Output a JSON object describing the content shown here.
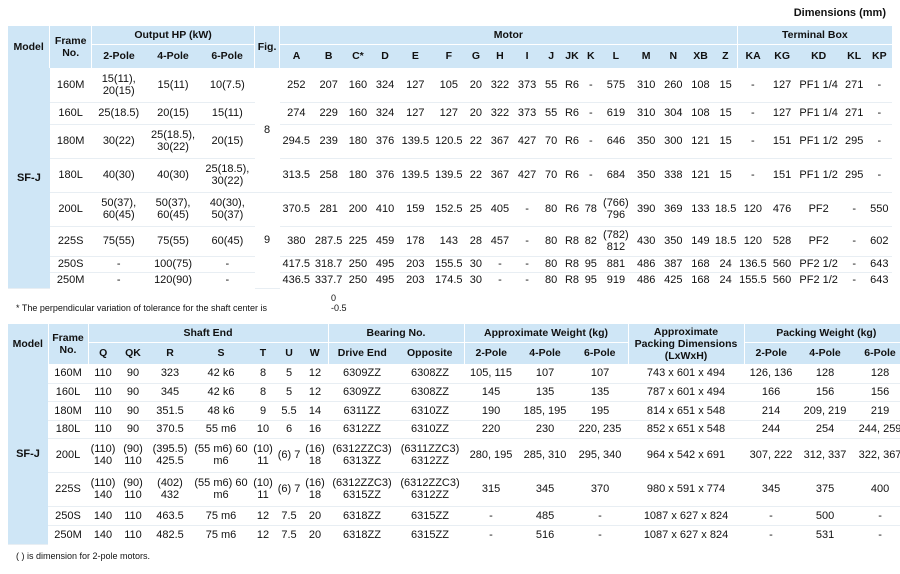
{
  "dims_title": "Dimensions (mm)",
  "t1": {
    "head": {
      "model": "Model",
      "frame": "Frame No.",
      "output": "Output HP (kW)",
      "fig": "Fig.",
      "motor": "Motor",
      "terminal": "Terminal Box",
      "output_cols": [
        "2-Pole",
        "4-Pole",
        "6-Pole"
      ],
      "motor_cols": [
        "A",
        "B",
        "C*",
        "D",
        "E",
        "F",
        "G",
        "H",
        "I",
        "J",
        "JK",
        "K",
        "L",
        "M",
        "N",
        "XB",
        "Z"
      ],
      "tb_cols": [
        "KA",
        "KG",
        "KD",
        "KL",
        "KP"
      ]
    },
    "model": "SF-J",
    "figs": [
      "8",
      "9"
    ],
    "rows": [
      [
        "160M",
        "15(11), 20(15)",
        "15(11)",
        "10(7.5)",
        "252",
        "207",
        "160",
        "324",
        "127",
        "105",
        "20",
        "322",
        "373",
        "55",
        "R6",
        "-",
        "575",
        "310",
        "260",
        "108",
        "15",
        "-",
        "127",
        "PF1 1/4",
        "271",
        "-"
      ],
      [
        "160L",
        "25(18.5)",
        "20(15)",
        "15(11)",
        "274",
        "229",
        "160",
        "324",
        "127",
        "127",
        "20",
        "322",
        "373",
        "55",
        "R6",
        "-",
        "619",
        "310",
        "304",
        "108",
        "15",
        "-",
        "127",
        "PF1 1/4",
        "271",
        "-"
      ],
      [
        "180M",
        "30(22)",
        "25(18.5), 30(22)",
        "20(15)",
        "294.5",
        "239",
        "180",
        "376",
        "139.5",
        "120.5",
        "22",
        "367",
        "427",
        "70",
        "R6",
        "-",
        "646",
        "350",
        "300",
        "121",
        "15",
        "-",
        "151",
        "PF1 1/2",
        "295",
        "-"
      ],
      [
        "180L",
        "40(30)",
        "40(30)",
        "25(18.5), 30(22)",
        "313.5",
        "258",
        "180",
        "376",
        "139.5",
        "139.5",
        "22",
        "367",
        "427",
        "70",
        "R6",
        "-",
        "684",
        "350",
        "338",
        "121",
        "15",
        "-",
        "151",
        "PF1 1/2",
        "295",
        "-"
      ],
      [
        "200L",
        "50(37), 60(45)",
        "50(37), 60(45)",
        "40(30), 50(37)",
        "370.5",
        "281",
        "200",
        "410",
        "159",
        "152.5",
        "25",
        "405",
        "-",
        "80",
        "R6",
        "78",
        "(766) 796",
        "390",
        "369",
        "133",
        "18.5",
        "120",
        "476",
        "PF2",
        "-",
        "550"
      ],
      [
        "225S",
        "75(55)",
        "75(55)",
        "60(45)",
        "380",
        "287.5",
        "225",
        "459",
        "178",
        "143",
        "28",
        "457",
        "-",
        "80",
        "R8",
        "82",
        "(782) 812",
        "430",
        "350",
        "149",
        "18.5",
        "120",
        "528",
        "PF2",
        "-",
        "602"
      ],
      [
        "250S",
        "-",
        "100(75)",
        "-",
        "417.5",
        "318.7",
        "250",
        "495",
        "203",
        "155.5",
        "30",
        "-",
        "-",
        "80",
        "R8",
        "95",
        "881",
        "486",
        "387",
        "168",
        "24",
        "136.5",
        "560",
        "PF2 1/2",
        "-",
        "643"
      ],
      [
        "250M",
        "-",
        "120(90)",
        "-",
        "436.5",
        "337.7",
        "250",
        "495",
        "203",
        "174.5",
        "30",
        "-",
        "-",
        "80",
        "R8",
        "95",
        "919",
        "486",
        "425",
        "168",
        "24",
        "155.5",
        "560",
        "PF2 1/2",
        "-",
        "643"
      ]
    ]
  },
  "note1": "* The perpendicular variation of tolerance for the shaft center is",
  "note1_tol": [
    "0",
    "-0.5"
  ],
  "t2": {
    "head": {
      "model": "Model",
      "frame": "Frame No.",
      "shaft": "Shaft End",
      "bearing": "Bearing No.",
      "weight": "Approximate Weight (kg)",
      "packdim": "Approximate Packing Dimensions (LxWxH)",
      "packw": "Packing Weight (kg)",
      "shaft_cols": [
        "Q",
        "QK",
        "R",
        "S",
        "T",
        "U",
        "W"
      ],
      "bearing_cols": [
        "Drive End",
        "Opposite"
      ],
      "weight_cols": [
        "2-Pole",
        "4-Pole",
        "6-Pole"
      ],
      "packw_cols": [
        "2-Pole",
        "4-Pole",
        "6-Pole"
      ]
    },
    "model": "SF-J",
    "rows": [
      [
        "160M",
        "110",
        "90",
        "323",
        "42 k6",
        "8",
        "5",
        "12",
        "6309ZZ",
        "6308ZZ",
        "105, 115",
        "107",
        "107",
        "743 x 601 x 494",
        "126, 136",
        "128",
        "128"
      ],
      [
        "160L",
        "110",
        "90",
        "345",
        "42 k6",
        "8",
        "5",
        "12",
        "6309ZZ",
        "6308ZZ",
        "145",
        "135",
        "135",
        "787 x 601 x 494",
        "166",
        "156",
        "156"
      ],
      [
        "180M",
        "110",
        "90",
        "351.5",
        "48 k6",
        "9",
        "5.5",
        "14",
        "6311ZZ",
        "6310ZZ",
        "190",
        "185, 195",
        "195",
        "814 x 651 x 548",
        "214",
        "209, 219",
        "219"
      ],
      [
        "180L",
        "110",
        "90",
        "370.5",
        "55 m6",
        "10",
        "6",
        "16",
        "6312ZZ",
        "6310ZZ",
        "220",
        "230",
        "220, 235",
        "852 x 651 x 548",
        "244",
        "254",
        "244, 259"
      ],
      [
        "200L",
        "(110) 140",
        "(90) 110",
        "(395.5) 425.5",
        "(55 m6) 60 m6",
        "(10) 11",
        "(6) 7",
        "(16) 18",
        "(6312ZZC3) 6313ZZ",
        "(6311ZZC3) 6312ZZ",
        "280, 195",
        "285, 310",
        "295, 340",
        "964 x 542 x 691",
        "307, 222",
        "312, 337",
        "322, 367"
      ],
      [
        "225S",
        "(110) 140",
        "(90) 110",
        "(402) 432",
        "(55 m6) 60 m6",
        "(10) 11",
        "(6) 7",
        "(16) 18",
        "(6312ZZC3) 6315ZZ",
        "(6312ZZC3) 6312ZZ",
        "315",
        "345",
        "370",
        "980 x 591 x 774",
        "345",
        "375",
        "400"
      ],
      [
        "250S",
        "140",
        "110",
        "463.5",
        "75 m6",
        "12",
        "7.5",
        "20",
        "6318ZZ",
        "6315ZZ",
        "-",
        "485",
        "-",
        "1087 x 627 x 824",
        "-",
        "500",
        "-"
      ],
      [
        "250M",
        "140",
        "110",
        "482.5",
        "75 m6",
        "12",
        "7.5",
        "20",
        "6318ZZ",
        "6315ZZ",
        "-",
        "516",
        "-",
        "1087 x 627 x 824",
        "-",
        "531",
        "-"
      ]
    ]
  },
  "note2": "( ) is dimension for 2-pole motors."
}
